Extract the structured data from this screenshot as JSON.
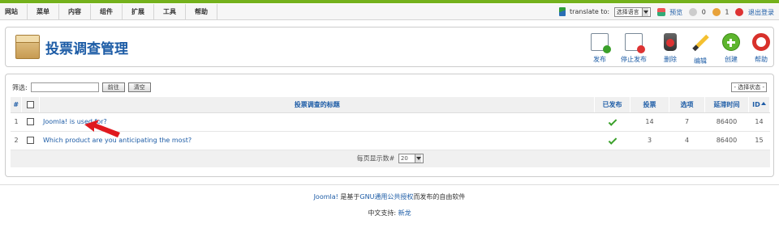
{
  "menu": [
    "网站",
    "菜单",
    "内容",
    "组件",
    "扩展",
    "工具",
    "帮助"
  ],
  "status": {
    "translate_label": "translate to:",
    "translate_value": "选择语言",
    "preview": "预览",
    "messages": "0",
    "users": "1",
    "logout": "退出登录"
  },
  "header": {
    "title": "投票调查管理",
    "buttons": [
      "发布",
      "停止发布",
      "删除",
      "编辑",
      "创建",
      "帮助"
    ]
  },
  "filter": {
    "label": "筛选:",
    "go": "前往",
    "reset": "清空",
    "state": "- 选择状态 -"
  },
  "table": {
    "columns": [
      "#",
      "投票调查的标题",
      "已发布",
      "投票",
      "选项",
      "延滞时间",
      "ID"
    ],
    "rows": [
      {
        "num": "1",
        "title": "Joomla! is used for?",
        "votes": "14",
        "options": "7",
        "lag": "86400",
        "id": "14"
      },
      {
        "num": "2",
        "title": "Which product are you anticipating the most?",
        "votes": "3",
        "options": "4",
        "lag": "86400",
        "id": "15"
      }
    ],
    "per_page_label": "每页显示数#",
    "per_page": "20"
  },
  "footer": {
    "joomla": "Joomla!",
    "mid": " 是基于",
    "gnu": "GNU通用公共授权",
    "rest": "而发布的自由软件",
    "support_label": "中文支持:",
    "support_link": "新龙"
  },
  "colors": {
    "accent": "#74b11c",
    "link": "#1d5ca6",
    "check": "#3aa02a"
  }
}
